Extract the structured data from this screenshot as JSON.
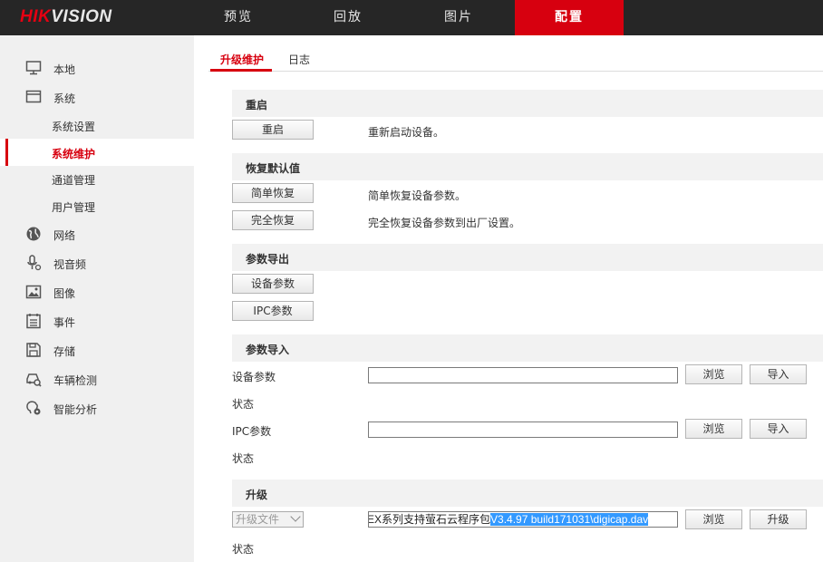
{
  "brand": {
    "part1": "HIK",
    "part2": "VISION"
  },
  "nav": {
    "tabs": [
      {
        "label": "预览"
      },
      {
        "label": "回放"
      },
      {
        "label": "图片"
      },
      {
        "label": "配置"
      }
    ],
    "active": "配置"
  },
  "sidebar": {
    "items": [
      {
        "label": "本地",
        "icon": "monitor-icon"
      },
      {
        "label": "系统",
        "icon": "window-icon"
      },
      {
        "label": "系统设置"
      },
      {
        "label": "系统维护"
      },
      {
        "label": "通道管理"
      },
      {
        "label": "用户管理"
      },
      {
        "label": "网络",
        "icon": "globe-icon"
      },
      {
        "label": "视音频",
        "icon": "microphone-icon"
      },
      {
        "label": "图像",
        "icon": "image-icon"
      },
      {
        "label": "事件",
        "icon": "calendar-list-icon"
      },
      {
        "label": "存储",
        "icon": "floppy-disk-icon"
      },
      {
        "label": "车辆检测",
        "icon": "vehicle-search-icon"
      },
      {
        "label": "智能分析",
        "icon": "smart-analysis-icon"
      }
    ],
    "active": "系统维护"
  },
  "subtabs": [
    {
      "label": "升级维护"
    },
    {
      "label": "日志"
    }
  ],
  "sections": {
    "reboot": {
      "title": "重启",
      "button": "重启",
      "desc": "重新启动设备。"
    },
    "restore": {
      "title": "恢复默认值",
      "simple_button": "简单恢复",
      "simple_desc": "简单恢复设备参数。",
      "full_button": "完全恢复",
      "full_desc": "完全恢复设备参数到出厂设置。"
    },
    "export": {
      "title": "参数导出",
      "device_button": "设备参数",
      "ipc_button": "IPC参数"
    },
    "import": {
      "title": "参数导入",
      "device_label": "设备参数",
      "device_value": "",
      "status1": "状态",
      "ipc_label": "IPC参数",
      "ipc_value": "",
      "status2": "状态",
      "browse": "浏览",
      "import": "导入"
    },
    "upgrade": {
      "title": "升级",
      "select_value": "升级文件",
      "file_prefix": "EX系列支持萤石云程序包",
      "file_selected": "V3.4.97 build171031\\digicap.dav",
      "browse": "浏览",
      "upgrade": "升级",
      "status": "状态"
    }
  },
  "colors": {
    "accent": "#d7000f",
    "topbar": "#262626",
    "sidebar": "#f0f0f0",
    "selection": "#3399ff"
  }
}
